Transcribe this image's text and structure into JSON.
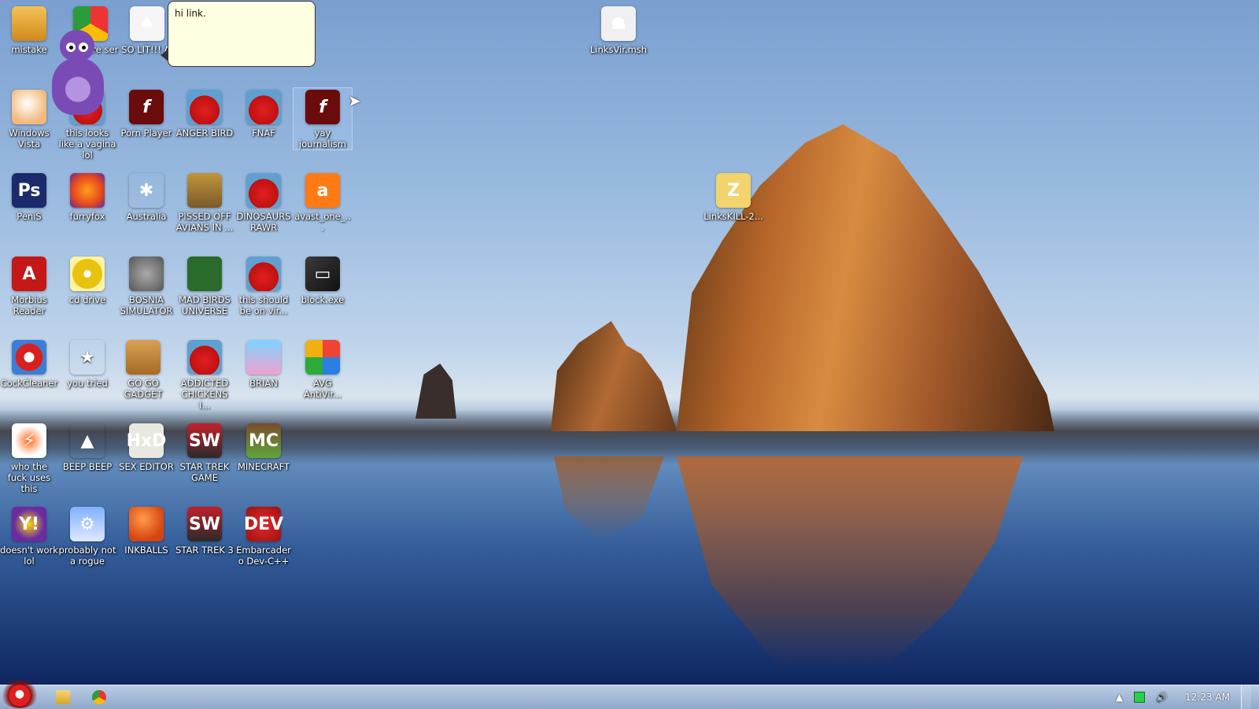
{
  "bonzi": {
    "speech": "hi link."
  },
  "desktop_icons": [
    {
      "label": "mistake"
    },
    {
      "label": "cure ser"
    },
    {
      "label": "SO LIT!!! AI"
    },
    {
      "label": "LinksVir.msh"
    },
    {
      "label": "Windows Vista"
    },
    {
      "label": "this looks like a vagina lol"
    },
    {
      "label": "Porn Player"
    },
    {
      "label": "ANGER BIRD"
    },
    {
      "label": "FNAF"
    },
    {
      "label": "yay journalism"
    },
    {
      "label": "PeniS"
    },
    {
      "label": "furryfox"
    },
    {
      "label": "Australia"
    },
    {
      "label": "PISSED OFF AVIANS IN ..."
    },
    {
      "label": "DINOSAURS RAWR"
    },
    {
      "label": "avast_one_..."
    },
    {
      "label": "LinksKILL-2..."
    },
    {
      "label": "Morbius Reader"
    },
    {
      "label": "cd drive"
    },
    {
      "label": "BOSNIA SIMULATOR"
    },
    {
      "label": "MAD BIRDS UNIVERSE"
    },
    {
      "label": "this should be on vir..."
    },
    {
      "label": "block.exe"
    },
    {
      "label": "CockCleaner"
    },
    {
      "label": "you tried"
    },
    {
      "label": "GO GO GADGET"
    },
    {
      "label": "ADDICTED CHICKENS I..."
    },
    {
      "label": "BRIAN"
    },
    {
      "label": "AVG AntiVir..."
    },
    {
      "label": "who the fuck uses this"
    },
    {
      "label": "BEEP BEEP"
    },
    {
      "label": "SEX EDITOR"
    },
    {
      "label": "STAR TREK GAME"
    },
    {
      "label": "MINECRAFT"
    },
    {
      "label": "doesn't work lol"
    },
    {
      "label": "probably not a rogue"
    },
    {
      "label": "INKBALLS"
    },
    {
      "label": "STAR TREK 3"
    },
    {
      "label": "Embarcadero Dev-C++"
    }
  ],
  "icon_glyphs": {
    "ps": "Ps",
    "flash": "f",
    "pdf": "A",
    "star": "★",
    "vlc": "▲",
    "hxd": "HxD",
    "mc": "MC",
    "dev": "DEV",
    "yahoo": "Y!",
    "avast": "a",
    "spider": "✱",
    "block": "▭",
    "zip": "Z",
    "cards": "♠",
    "startrek": "SW",
    "start": "●"
  },
  "taskbar": {
    "clock": "12:23 AM",
    "tray_arrow": "▲",
    "tray_volume": "🔊"
  }
}
